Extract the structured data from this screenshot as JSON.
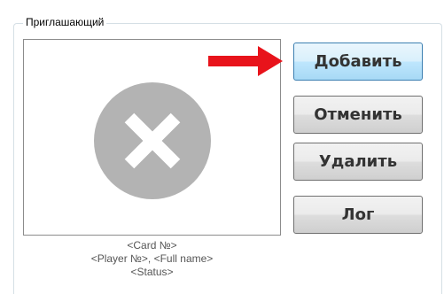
{
  "group": {
    "title": "Приглашающий"
  },
  "buttons": {
    "add": "Добавить",
    "cancel": "Отменить",
    "delete": "Удалить",
    "log": "Лог"
  },
  "player": {
    "card": "<Card №>",
    "player_and_name": "<Player №>, <Full name>",
    "status": "<Status>"
  },
  "icons": {
    "photo_placeholder": "x-circle-icon",
    "pointer": "right-arrow-icon"
  },
  "colors": {
    "placeholder_gray": "#b3b3b3",
    "arrow_red": "#e8131b",
    "active_button_border": "#3c7fb1"
  }
}
